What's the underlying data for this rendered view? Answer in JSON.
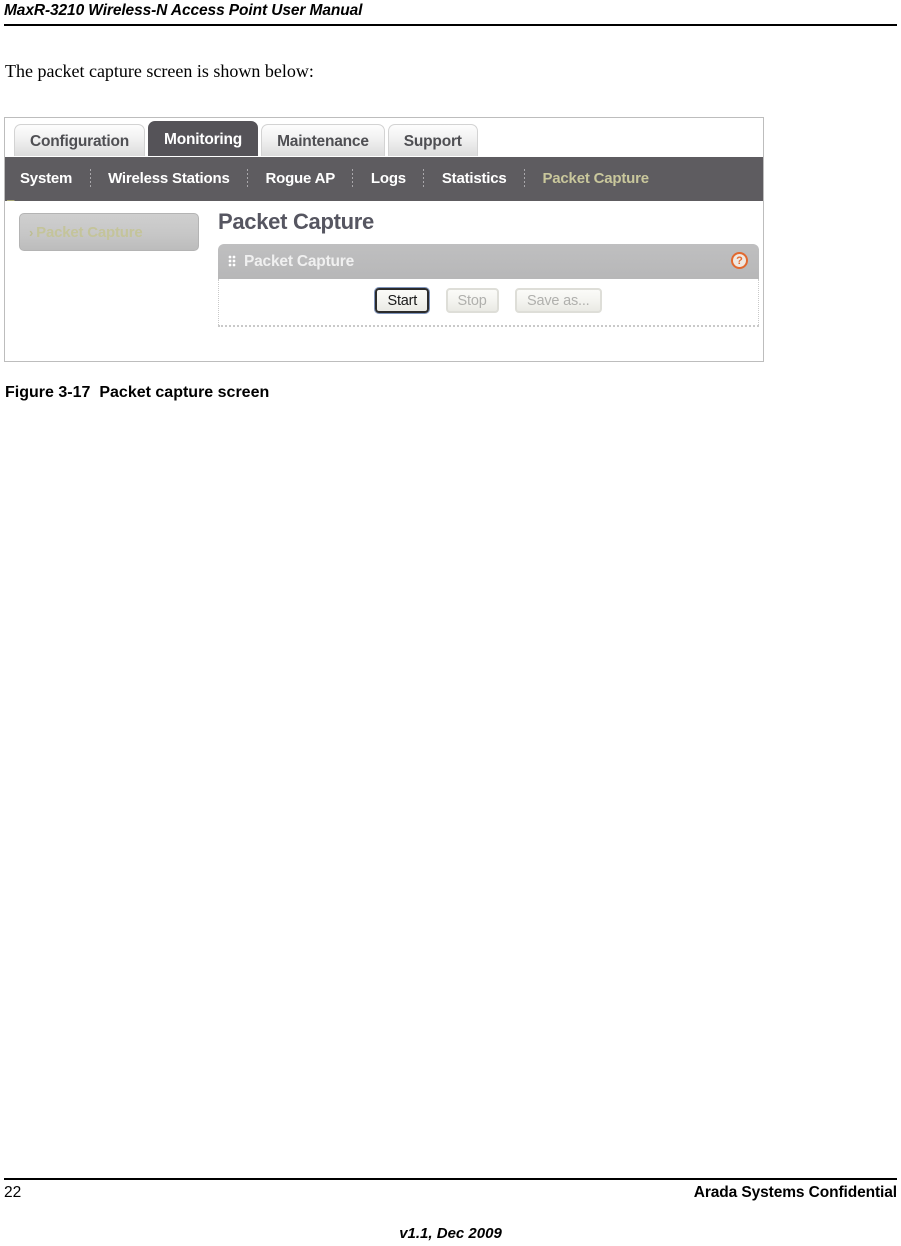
{
  "page": {
    "header_title": "MaxR-3210 Wireless-N Access Point User Manual",
    "intro_paragraph": "The packet capture screen is shown below:",
    "figure_label": "Figure 3-17",
    "figure_caption": "Packet capture screen"
  },
  "footer": {
    "page_number": "22",
    "confidential_notice": "Arada Systems Confidential",
    "version": "v1.1, Dec 2009"
  },
  "screenshot": {
    "tabs": [
      {
        "label": "Configuration",
        "active": false
      },
      {
        "label": "Monitoring",
        "active": true
      },
      {
        "label": "Maintenance",
        "active": false
      },
      {
        "label": "Support",
        "active": false
      }
    ],
    "subnav": [
      {
        "label": "System",
        "current": false
      },
      {
        "label": "Wireless Stations",
        "current": false
      },
      {
        "label": "Rogue AP",
        "current": false
      },
      {
        "label": "Logs",
        "current": false
      },
      {
        "label": "Statistics",
        "current": false
      },
      {
        "label": "Packet Capture",
        "current": true
      }
    ],
    "sidebar": {
      "items": [
        {
          "chevron": "›",
          "label": "Packet Capture"
        }
      ]
    },
    "content": {
      "page_title": "Packet Capture",
      "panel": {
        "grip_icon": "grip-dots-icon",
        "title": "Packet Capture",
        "help_icon": "?",
        "buttons": [
          {
            "label": "Start",
            "state": "enabled"
          },
          {
            "label": "Stop",
            "state": "disabled"
          },
          {
            "label": "Save as...",
            "state": "disabled"
          }
        ]
      }
    },
    "colors": {
      "active_tab_bg": "#555358",
      "subnav_bg": "#5e5c60",
      "current_subnav_text": "#c9c79c",
      "panel_header_bg": "#bfbfc0",
      "page_title_text": "#565661",
      "help_icon": "#e2692f",
      "sidebar_item_text": "#c4c49a"
    }
  }
}
